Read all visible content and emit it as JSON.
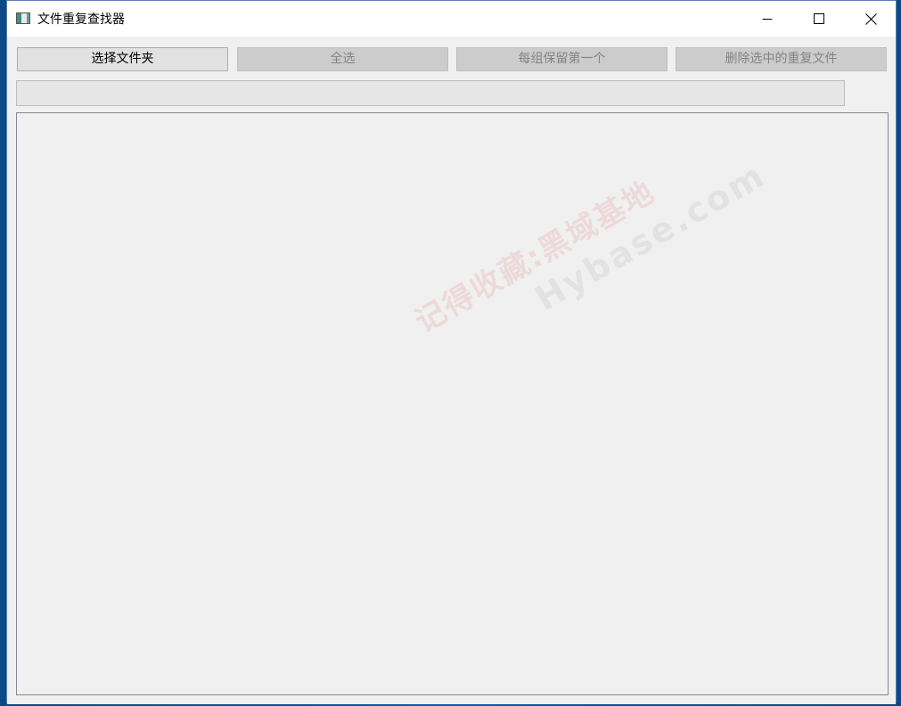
{
  "window": {
    "title": "文件重复查找器",
    "controls": {
      "minimize": "minimize",
      "maximize": "maximize",
      "close": "close"
    }
  },
  "toolbar": {
    "select_folder_label": "选择文件夹",
    "select_all_label": "全选",
    "keep_first_label": "每组保留第一个",
    "delete_selected_label": "删除选中的重复文件"
  },
  "progress": {
    "value": 0
  },
  "watermark": {
    "line1": "记得收藏:黑域基地",
    "line2": "Hybase.com"
  },
  "colors": {
    "window_bg": "#f0f0f0",
    "titlebar_bg": "#ffffff",
    "button_enabled_bg": "#e1e1e1",
    "button_disabled_bg": "#cccccc",
    "disabled_text": "#838383"
  },
  "icons": {
    "app": "app-window-icon",
    "minimize": "minimize-icon",
    "maximize": "maximize-icon",
    "close": "close-icon"
  }
}
